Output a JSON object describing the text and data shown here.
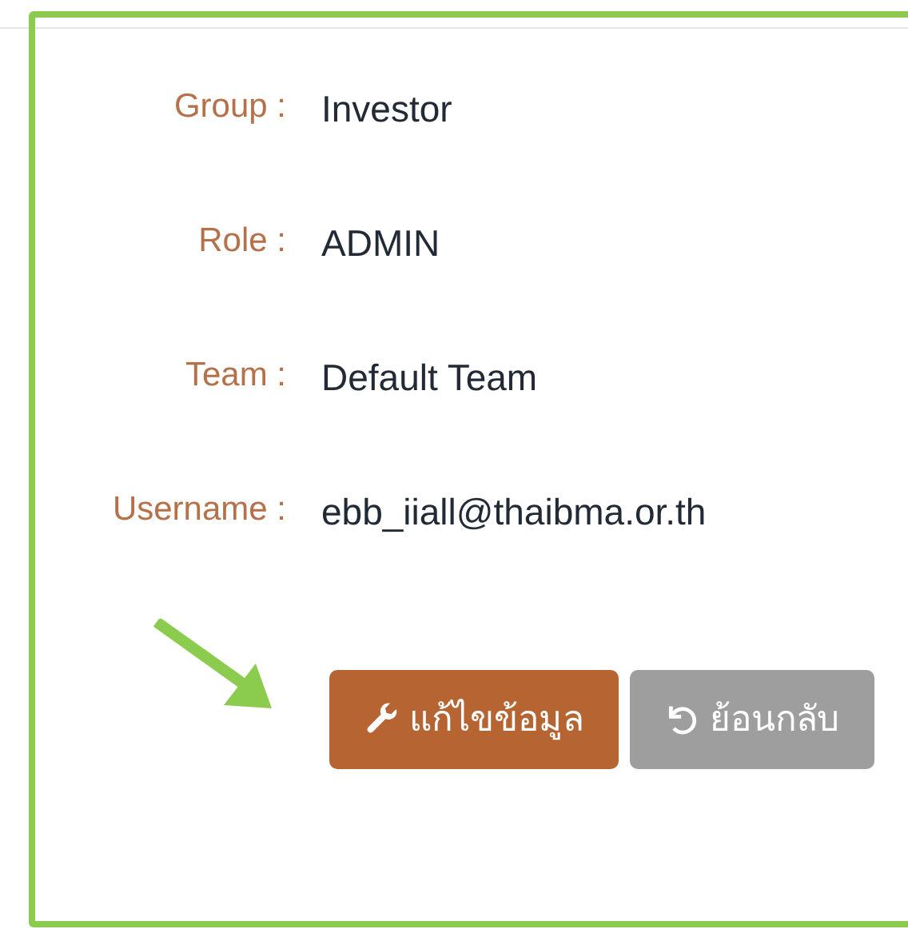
{
  "fields": [
    {
      "label": "Group :",
      "value": "Investor"
    },
    {
      "label": "Role :",
      "value": "ADMIN"
    },
    {
      "label": "Team :",
      "value": "Default Team"
    },
    {
      "label": "Username :",
      "value": "ebb_iiall@thaibma.or.th"
    }
  ],
  "buttons": [
    {
      "label": "แก้ไขข้อมูล",
      "kind": "edit"
    },
    {
      "label": "ย้อนกลับ",
      "kind": "back"
    }
  ]
}
